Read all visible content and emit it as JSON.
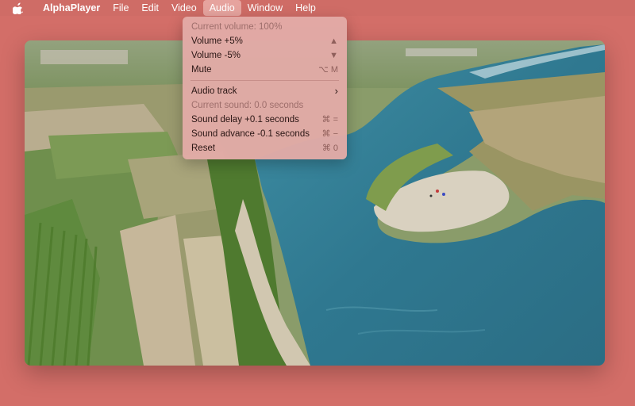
{
  "menubar": {
    "app_name": "AlphaPlayer",
    "items": [
      "File",
      "Edit",
      "Video",
      "Audio",
      "Window",
      "Help"
    ],
    "active": "Audio"
  },
  "audio_menu": {
    "current_volume": "Current volume: 100%",
    "volume_up": "Volume +5%",
    "volume_up_shortcut": "▲",
    "volume_down": "Volume -5%",
    "volume_down_shortcut": "▼",
    "mute": "Mute",
    "mute_shortcut": "⌥ M",
    "audio_track": "Audio track",
    "audio_track_arrow": "›",
    "current_sound": "Current sound: 0.0 seconds",
    "sound_delay": "Sound delay +0.1 seconds",
    "sound_delay_shortcut": "⌘ =",
    "sound_advance": "Sound advance -0.1 seconds",
    "sound_advance_shortcut": "⌘ −",
    "reset": "Reset",
    "reset_shortcut": "⌘ 0"
  },
  "colors": {
    "desktop": "#d36e68",
    "menu_highlight": "#e6a39e"
  }
}
